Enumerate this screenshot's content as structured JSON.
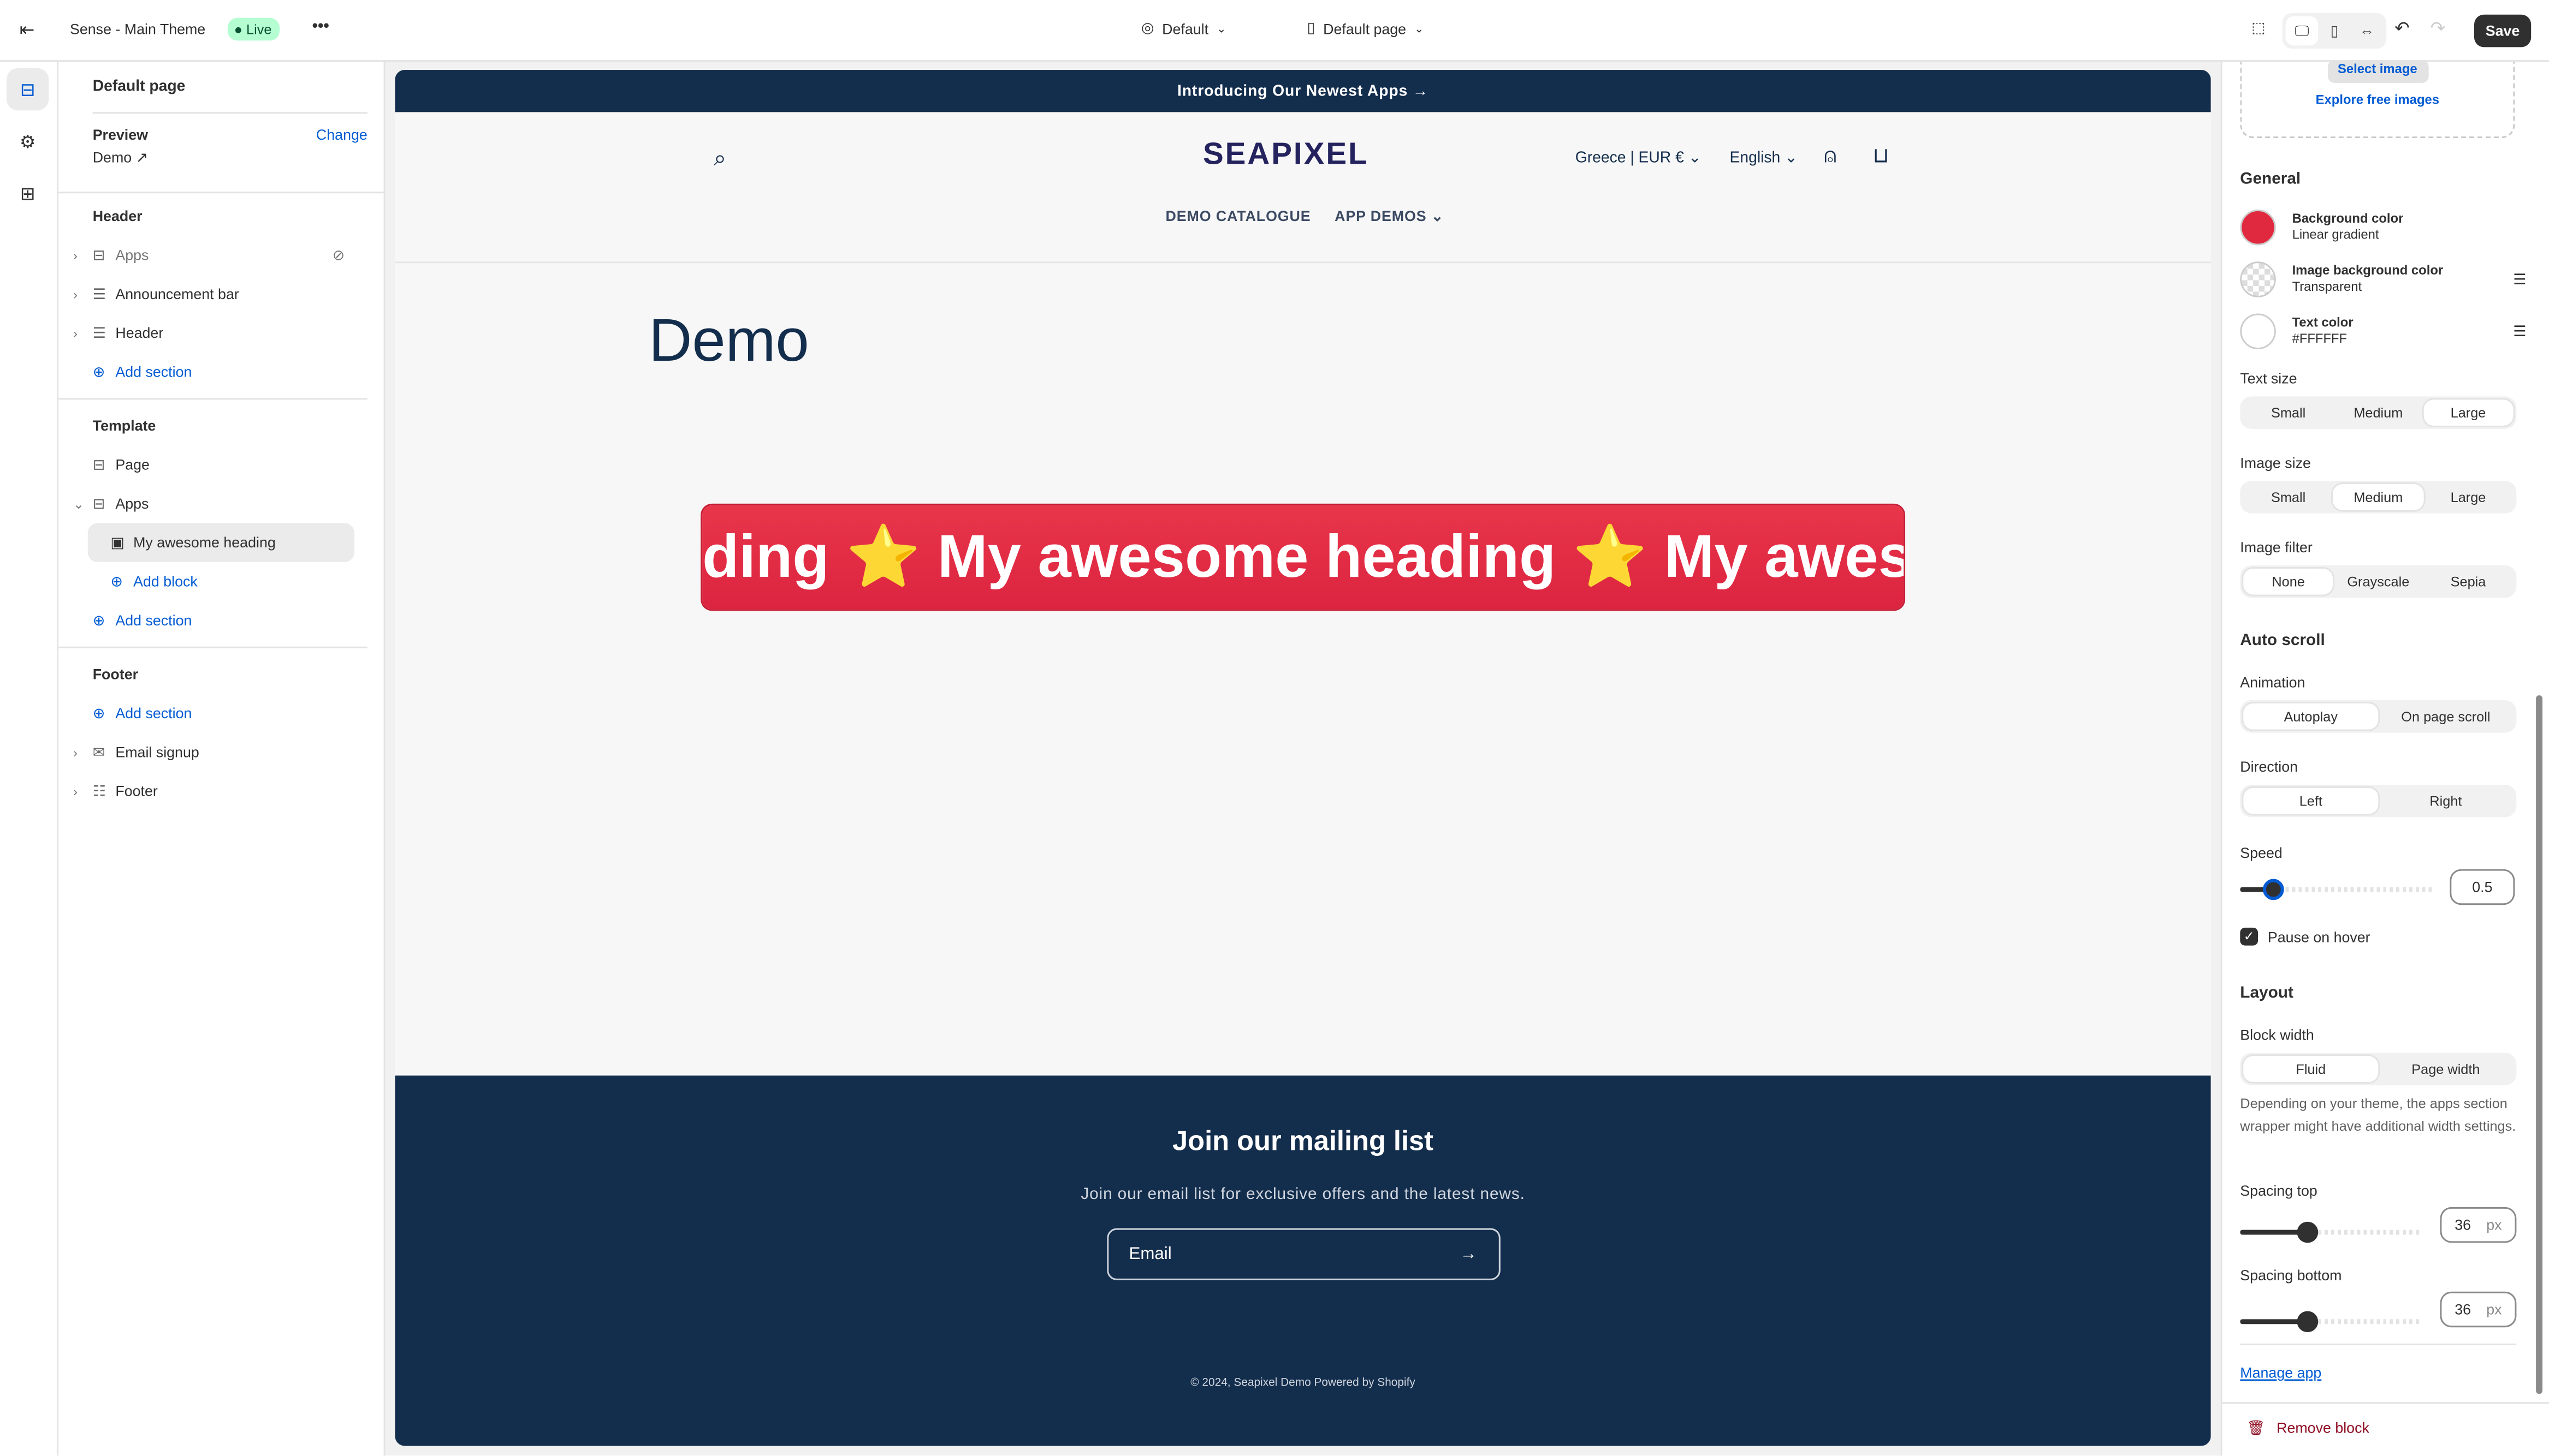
{
  "topbar": {
    "theme_name": "Sense - Main Theme",
    "status_badge": "Live",
    "more": "•••",
    "theme_preset": "Default",
    "page_selector": "Default page",
    "save_label": "Save"
  },
  "left_panel": {
    "title": "Default page",
    "preview_label": "Preview",
    "change_label": "Change",
    "preview_value": "Demo",
    "header_group": {
      "title": "Header",
      "items": [
        {
          "label": "Apps",
          "hidden": true
        },
        {
          "label": "Announcement bar"
        },
        {
          "label": "Header"
        }
      ],
      "add_section": "Add section"
    },
    "template_group": {
      "title": "Template",
      "items": [
        {
          "label": "Page"
        },
        {
          "label": "Apps"
        }
      ],
      "block": "My awesome heading",
      "add_block": "Add block",
      "add_section": "Add section"
    },
    "footer_group": {
      "title": "Footer",
      "add_section": "Add section",
      "items": [
        {
          "label": "Email signup"
        },
        {
          "label": "Footer"
        }
      ]
    }
  },
  "store": {
    "announcement": "Introducing Our Newest Apps →",
    "logo": "SEAPIXEL",
    "country": "Greece | EUR €",
    "language": "English",
    "nav": [
      "DEMO CATALOGUE",
      "APP DEMOS"
    ],
    "page_title": "Demo",
    "marquee": "ding ⭐ My awesome heading ⭐ My aweson",
    "newsletter_title": "Join our mailing list",
    "newsletter_text": "Join our email list for exclusive offers and the latest news.",
    "email_placeholder": "Email",
    "copyright": "© 2024, Seapixel Demo Powered by Shopify",
    "colors": {
      "navy": "#132d4c",
      "marquee": "#e0283f"
    }
  },
  "right_panel": {
    "select_image": "Select image",
    "explore_images": "Explore free images",
    "general": "General",
    "colors": [
      {
        "label": "Background color",
        "value": "Linear gradient",
        "swatch": "#e0283f"
      },
      {
        "label": "Image background color",
        "value": "Transparent"
      },
      {
        "label": "Text color",
        "value": "#FFFFFF",
        "swatch": "#FFFFFF"
      }
    ],
    "text_size": {
      "label": "Text size",
      "options": [
        "Small",
        "Medium",
        "Large"
      ],
      "selected": "Large"
    },
    "image_size": {
      "label": "Image size",
      "options": [
        "Small",
        "Medium",
        "Large"
      ],
      "selected": "Medium"
    },
    "image_filter": {
      "label": "Image filter",
      "options": [
        "None",
        "Grayscale",
        "Sepia"
      ],
      "selected": "None"
    },
    "auto_scroll": "Auto scroll",
    "animation": {
      "label": "Animation",
      "options": [
        "Autoplay",
        "On page scroll"
      ],
      "selected": "Autoplay"
    },
    "direction": {
      "label": "Direction",
      "options": [
        "Left",
        "Right"
      ],
      "selected": "Left"
    },
    "speed": {
      "label": "Speed",
      "value": "0.5",
      "level_percent": 17
    },
    "pause_on_hover": {
      "label": "Pause on hover",
      "checked": true
    },
    "layout": "Layout",
    "block_width": {
      "label": "Block width",
      "options": [
        "Fluid",
        "Page width"
      ],
      "selected": "Fluid",
      "help": "Depending on your theme, the apps section wrapper might have additional width settings."
    },
    "spacing_top": {
      "label": "Spacing top",
      "value": "36",
      "unit": "px",
      "level_percent": 37
    },
    "spacing_bottom": {
      "label": "Spacing bottom",
      "value": "36",
      "unit": "px",
      "level_percent": 37
    },
    "manage_app": "Manage app",
    "remove_block": "Remove block"
  }
}
